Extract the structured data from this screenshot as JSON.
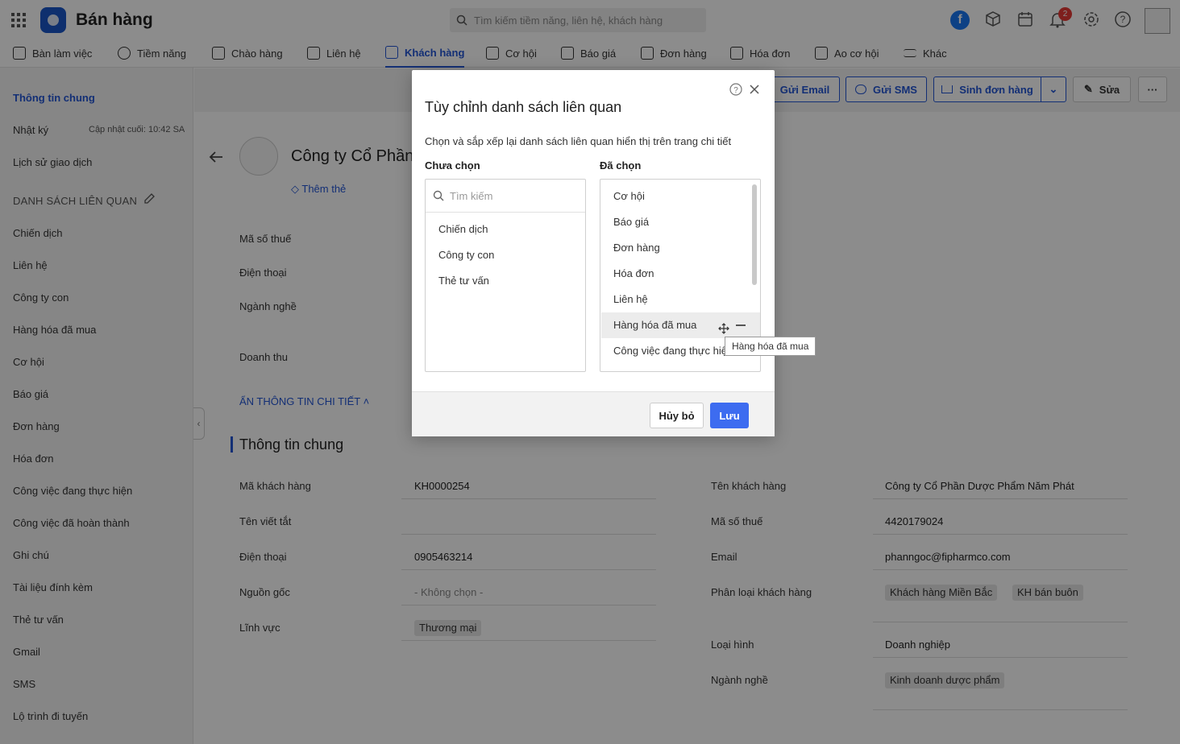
{
  "topbar": {
    "app_title": "Bán hàng",
    "search_placeholder": "Tìm kiếm tiềm năng, liên hệ, khách hàng",
    "notification_count": "2"
  },
  "nav": [
    {
      "label": "Bàn làm việc",
      "icon": "home-icon"
    },
    {
      "label": "Tiềm năng",
      "icon": "lead-icon"
    },
    {
      "label": "Chào hàng",
      "icon": "magnet-icon"
    },
    {
      "label": "Liên hệ",
      "icon": "contact-icon"
    },
    {
      "label": "Khách hàng",
      "icon": "building-icon",
      "active": true
    },
    {
      "label": "Cơ hội",
      "icon": "briefcase-icon"
    },
    {
      "label": "Báo giá",
      "icon": "quote-icon"
    },
    {
      "label": "Đơn hàng",
      "icon": "cart-icon"
    },
    {
      "label": "Hóa đơn",
      "icon": "invoice-icon"
    },
    {
      "label": "Ao cơ hội",
      "icon": "funnel-icon"
    },
    {
      "label": "Khác",
      "icon": "menu-icon"
    }
  ],
  "sidebar": {
    "general": "Thông tin chung",
    "log": "Nhật ký",
    "last_update": "Cập nhật cuối: 10:42 SA",
    "history": "Lịch sử giao dịch",
    "related_header": "DANH SÁCH LIÊN QUAN",
    "items": [
      "Chiến dịch",
      "Liên hệ",
      "Công ty con",
      "Hàng hóa đã mua",
      "Cơ hội",
      "Báo giá",
      "Đơn hàng",
      "Hóa đơn",
      "Công việc đang thực hiện",
      "Công việc đã hoàn thành",
      "Ghi chú",
      "Tài liệu đính kèm",
      "Thẻ tư vấn",
      "Gmail",
      "SMS",
      "Lộ trình đi tuyến"
    ]
  },
  "actions": {
    "email": "Gửi Email",
    "sms": "Gửi SMS",
    "order": "Sinh đơn hàng",
    "edit": "Sửa"
  },
  "record": {
    "name": "Công ty Cổ Phần",
    "add_tag": "Thêm thẻ",
    "summary_labels": [
      "Mã số thuế",
      "Điện thoại",
      "Ngành nghề",
      "Doanh thu"
    ],
    "hide_details": "ẨN THÔNG TIN CHI TIẾT",
    "section_title": "Thông tin chung",
    "left_fields": [
      {
        "label": "Mã khách hàng",
        "value": "KH0000254"
      },
      {
        "label": "Tên viết tắt",
        "value": ""
      },
      {
        "label": "Điện thoại",
        "value": "0905463214"
      },
      {
        "label": "Nguồn gốc",
        "value": "- Không chọn -"
      },
      {
        "label": "Lĩnh vực",
        "value": "Thương mại"
      }
    ],
    "right_fields": [
      {
        "label": "Tên khách hàng",
        "value": "Công ty Cổ Phần Dược Phẩm Năm Phát"
      },
      {
        "label": "Mã số thuế",
        "value": "4420179024"
      },
      {
        "label": "Email",
        "value": "phanngoc@fipharmco.com"
      },
      {
        "label": "Phân loại khách hàng",
        "tags": [
          "Khách hàng Miền Bắc",
          "KH bán buôn"
        ]
      },
      {
        "label": "Loại hình",
        "value": "Doanh nghiệp"
      },
      {
        "label": "Ngành nghề",
        "tags": [
          "Kinh doanh dược phẩm"
        ]
      }
    ]
  },
  "modal": {
    "title": "Tùy chỉnh danh sách liên quan",
    "description": "Chọn và sắp xếp lại danh sách liên quan hiển thị trên trang chi tiết",
    "unselected_title": "Chưa chọn",
    "selected_title": "Đã chọn",
    "search_placeholder": "Tìm kiếm",
    "unselected": [
      "Chiến dịch",
      "Công ty con",
      "Thẻ tư vấn"
    ],
    "selected": [
      "Cơ hội",
      "Báo giá",
      "Đơn hàng",
      "Hóa đơn",
      "Liên hệ",
      "Hàng hóa đã mua",
      "Công việc đang thực hiện"
    ],
    "tooltip": "Hàng hóa đã mua",
    "cancel": "Hủy bỏ",
    "save": "Lưu"
  },
  "colors": {
    "accent": "#2456d6",
    "badge": "#e53935"
  }
}
